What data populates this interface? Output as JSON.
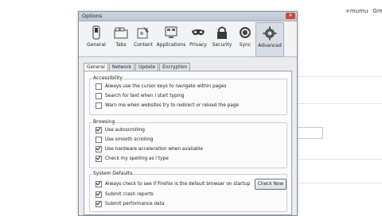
{
  "background": {
    "top_right": [
      "+mumu",
      "Gm"
    ]
  },
  "dialog": {
    "title": "Options",
    "close_label": "✕"
  },
  "toolbar": {
    "items": [
      {
        "label": "General",
        "icon": "switch-icon"
      },
      {
        "label": "Tabs",
        "icon": "tabs-icon"
      },
      {
        "label": "Content",
        "icon": "content-icon"
      },
      {
        "label": "Applications",
        "icon": "applications-icon"
      },
      {
        "label": "Privacy",
        "icon": "mask-icon"
      },
      {
        "label": "Security",
        "icon": "lock-icon"
      },
      {
        "label": "Sync",
        "icon": "sync-icon"
      },
      {
        "label": "Advanced",
        "icon": "gear-icon",
        "selected": true
      }
    ]
  },
  "subtabs": [
    "General",
    "Network",
    "Update",
    "Encryption"
  ],
  "groups": {
    "accessibility": {
      "title": "Accessibility",
      "options": [
        {
          "label": "Always use the cursor keys to navigate within pages",
          "checked": false
        },
        {
          "label": "Search for text when I start typing",
          "checked": false
        },
        {
          "label": "Warn me when websites try to redirect or reload the page",
          "checked": false
        }
      ]
    },
    "browsing": {
      "title": "Browsing",
      "options": [
        {
          "label": "Use autoscrolling",
          "checked": true
        },
        {
          "label": "Use smooth scrolling",
          "checked": false
        },
        {
          "label": "Use hardware acceleration when available",
          "checked": true
        },
        {
          "label": "Check my spelling as I type",
          "checked": true
        }
      ]
    },
    "system": {
      "title": "System Defaults",
      "options": [
        {
          "label": "Always check to see if Firefox is the default browser on startup",
          "checked": true
        },
        {
          "label": "Submit crash reports",
          "checked": true
        },
        {
          "label": "Submit performance data",
          "checked": true
        }
      ],
      "check_now_label": "Check Now"
    }
  },
  "colors": {
    "dialog_bg": "#e9ebee",
    "selected_toolbar_bg": "#d7dde5"
  }
}
